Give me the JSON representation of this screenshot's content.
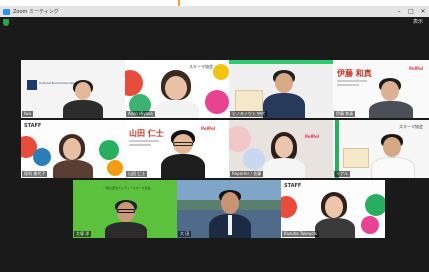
{
  "window": {
    "title": "Zoom ミーティング"
  },
  "titlebar": {
    "minimize": "–",
    "maximize": "□",
    "close": "✕"
  },
  "toolbar": {
    "view_label": "表示"
  },
  "tiles": [
    {
      "name": "Iwa",
      "org": "Cultural Economics Association",
      "hand": ""
    },
    {
      "name": "Allen Hiyasa",
      "org": "スキーマ協会",
      "hand": ""
    },
    {
      "name": "ヒノキノウト 中代",
      "org": "",
      "hand": ""
    },
    {
      "name": "伊藤 和真",
      "org": "PolPol",
      "hand": ""
    },
    {
      "name": "保利 美代子",
      "org": "STAFF",
      "hand": ""
    },
    {
      "name": "山田 仁士",
      "org": "PolPol",
      "hand": ""
    },
    {
      "name": "Reporter / 佐藤",
      "org": "PolPol",
      "hand": ""
    },
    {
      "name": "リアル",
      "org": "スキーマ協会",
      "hand": ""
    },
    {
      "name": "大塚 洋",
      "org": "一般社団法人シティースキーマ協会",
      "hand": ""
    },
    {
      "name": "大 田",
      "org": "",
      "hand": ""
    },
    {
      "name": "Kazuha Takeuchi",
      "org": "STAFF",
      "hand": ""
    }
  ]
}
